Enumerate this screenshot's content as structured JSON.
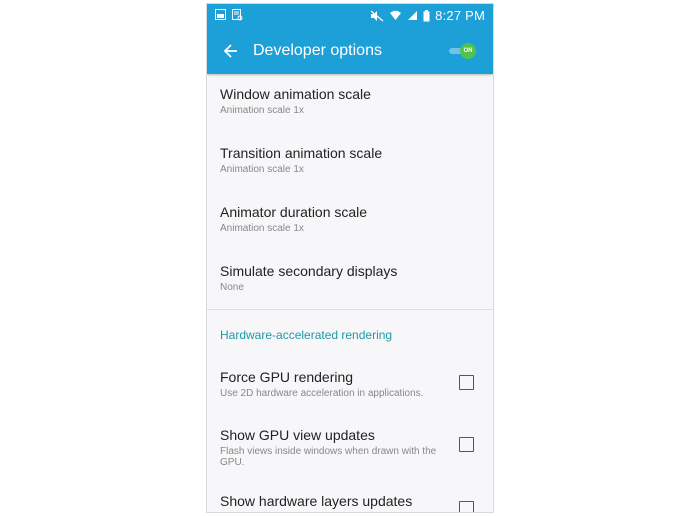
{
  "statusbar": {
    "time": "8:27 PM",
    "battery": "battery-icon"
  },
  "appbar": {
    "title": "Developer options",
    "toggle_label": "ON"
  },
  "items": [
    {
      "title": "Window animation scale",
      "subtitle": "Animation scale 1x"
    },
    {
      "title": "Transition animation scale",
      "subtitle": "Animation scale 1x"
    },
    {
      "title": "Animator duration scale",
      "subtitle": "Animation scale 1x"
    },
    {
      "title": "Simulate secondary displays",
      "subtitle": "None"
    }
  ],
  "section": {
    "label": "Hardware-accelerated rendering"
  },
  "checkbox_items": [
    {
      "title": "Force GPU rendering",
      "subtitle": "Use 2D hardware acceleration in applications."
    },
    {
      "title": "Show GPU view updates",
      "subtitle": "Flash views inside windows when drawn with the GPU."
    },
    {
      "title": "Show hardware layers updates",
      "subtitle": ""
    }
  ],
  "colors": {
    "accent": "#1d9fd8",
    "toggle_on": "#53c24a",
    "section_text": "#1d9aa6"
  }
}
